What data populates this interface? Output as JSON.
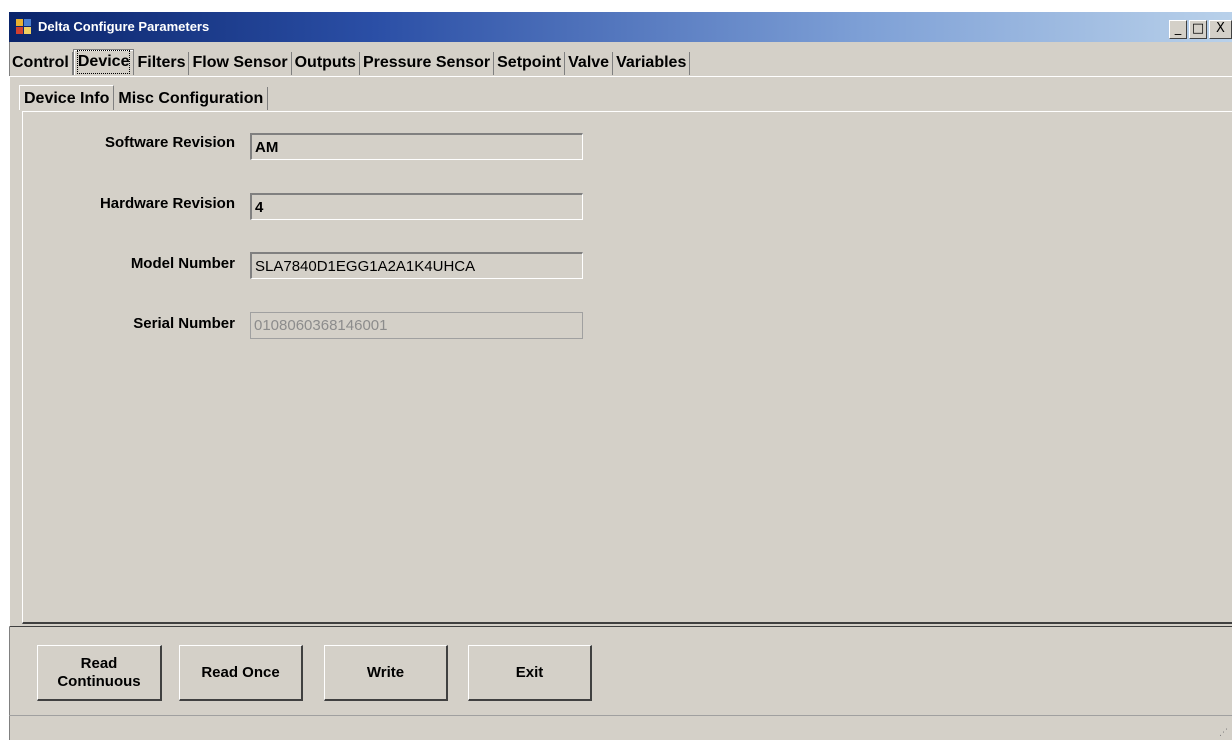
{
  "window": {
    "title": "Delta Configure Parameters",
    "minimize_glyph": "_",
    "maximize_glyph": "□",
    "close_glyph": "X",
    "icon": "app-window-icon"
  },
  "main_tabs": [
    {
      "label": "Control",
      "active": false
    },
    {
      "label": "Device",
      "active": true
    },
    {
      "label": "Filters",
      "active": false
    },
    {
      "label": "Flow Sensor",
      "active": false
    },
    {
      "label": "Outputs",
      "active": false
    },
    {
      "label": "Pressure Sensor",
      "active": false
    },
    {
      "label": "Setpoint",
      "active": false
    },
    {
      "label": "Valve",
      "active": false
    },
    {
      "label": "Variables",
      "active": false
    }
  ],
  "sub_tabs": [
    {
      "label": "Device Info",
      "active": true
    },
    {
      "label": "Misc Configuration",
      "active": false
    }
  ],
  "device_info": {
    "software_revision": {
      "label": "Software Revision",
      "value": "AM"
    },
    "hardware_revision": {
      "label": "Hardware Revision",
      "value": "4"
    },
    "model_number": {
      "label": "Model Number",
      "value": "SLA7840D1EGG1A2A1K4UHCA"
    },
    "serial_number": {
      "label": "Serial Number",
      "value": "0108060368146001"
    }
  },
  "buttons": {
    "read_continuous_line1": "Read",
    "read_continuous_line2": "Continuous",
    "read_once": "Read Once",
    "write": "Write",
    "exit": "Exit"
  },
  "colors": {
    "face": "#d4d0c8",
    "title_start": "#0a246a",
    "title_end": "#b9d1ea",
    "disabled_text": "#8c8c8c"
  }
}
